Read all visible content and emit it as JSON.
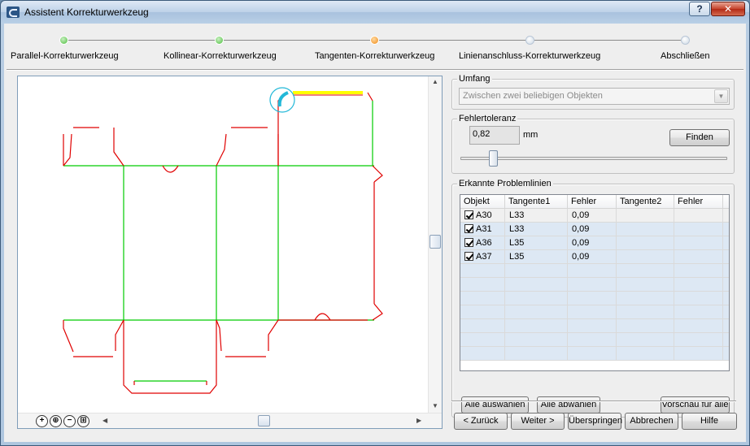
{
  "window": {
    "title": "Assistent Korrekturwerkzeug",
    "help_label": "?",
    "close_label": "✕"
  },
  "steps": [
    {
      "label": "Parallel-Korrekturwerkzeug",
      "state": "done"
    },
    {
      "label": "Kollinear-Korrekturwerkzeug",
      "state": "done"
    },
    {
      "label": "Tangenten-Korrekturwerkzeug",
      "state": "active"
    },
    {
      "label": "Linienanschluss-Korrekturwerkzeug",
      "state": "todo"
    },
    {
      "label": "Abschließen",
      "state": "todo"
    }
  ],
  "colors": {
    "cut_line": "#e00000",
    "crease_line": "#00cc00",
    "highlight_line": "#ffff00",
    "highlight_circle": "#22b8d8",
    "step_done": "#4cbd3e",
    "step_active": "#ef8a16"
  },
  "umfang": {
    "label": "Umfang",
    "selected": "Zwischen zwei beliebigen Objekten"
  },
  "fehlertoleranz": {
    "label": "Fehlertoleranz",
    "value": "0,82",
    "unit": "mm",
    "find_button": "Finden",
    "slider_level": 0.11
  },
  "problems": {
    "label": "Erkannte Problemlinien",
    "columns": [
      "Objekt",
      "Tangente1",
      "Fehler",
      "Tangente2",
      "Fehler"
    ],
    "rows": [
      {
        "checked": true,
        "objekt": "A30",
        "tangente1": "L33",
        "fehler": "0,09",
        "tangente2": "",
        "fehler2": ""
      },
      {
        "checked": true,
        "objekt": "A31",
        "tangente1": "L33",
        "fehler": "0,09",
        "tangente2": "",
        "fehler2": ""
      },
      {
        "checked": true,
        "objekt": "A36",
        "tangente1": "L35",
        "fehler": "0,09",
        "tangente2": "",
        "fehler2": ""
      },
      {
        "checked": true,
        "objekt": "A37",
        "tangente1": "L35",
        "fehler": "0,09",
        "tangente2": "",
        "fehler2": ""
      }
    ],
    "select_all": "Alle auswählen",
    "deselect_all": "Alle abwählen",
    "preview_all": "Vorschau für alle"
  },
  "footer": {
    "back": "< Zurück",
    "next": "Weiter >",
    "skip": "Überspringen",
    "cancel": "Abbrechen",
    "help": "Hilfe"
  },
  "zoom_icons": [
    "zoom-in-icon",
    "zoom-window-icon",
    "zoom-out-icon",
    "zoom-fit-icon"
  ]
}
